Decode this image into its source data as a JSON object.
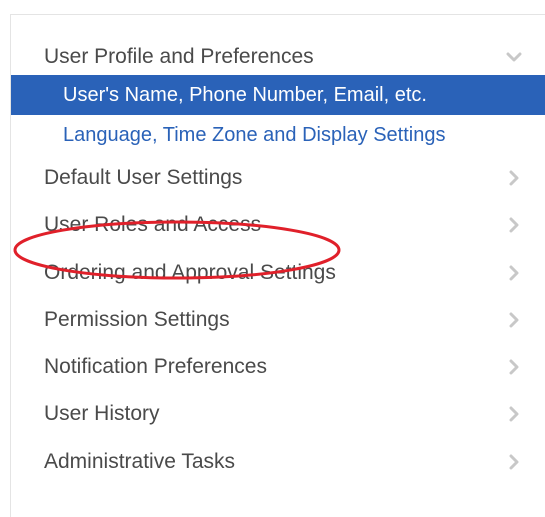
{
  "menu": {
    "expanded_section": {
      "label": "User Profile and Preferences",
      "icon": "chevron-down-icon",
      "subitems": [
        {
          "label": "User's Name, Phone Number, Email, etc.",
          "active": true
        },
        {
          "label": "Language, Time Zone and Display Settings",
          "active": false
        }
      ]
    },
    "sections": [
      {
        "label": "Default User Settings",
        "icon": "chevron-right-icon"
      },
      {
        "label": "User Roles and Access",
        "icon": "chevron-right-icon",
        "highlighted": true
      },
      {
        "label": "Ordering and Approval Settings",
        "icon": "chevron-right-icon"
      },
      {
        "label": "Permission Settings",
        "icon": "chevron-right-icon"
      },
      {
        "label": "Notification Preferences",
        "icon": "chevron-right-icon"
      },
      {
        "label": "User History",
        "icon": "chevron-right-icon"
      },
      {
        "label": "Administrative Tasks",
        "icon": "chevron-right-icon"
      }
    ]
  },
  "colors": {
    "accent": "#2a62b8",
    "text": "#4a4a4a",
    "chevron": "#c8c8c8",
    "annotation": "#e0202a"
  }
}
